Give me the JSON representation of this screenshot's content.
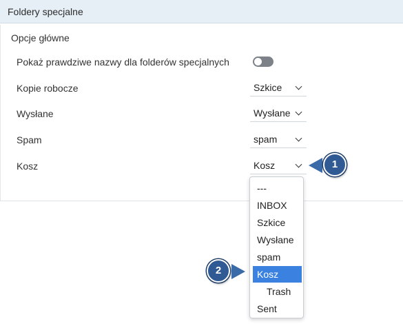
{
  "header": {
    "title": "Foldery specjalne"
  },
  "section": {
    "legend": "Opcje główne"
  },
  "rows": [
    {
      "label": "Pokaż prawdziwe nazwy dla folderów specjalnych",
      "type": "toggle",
      "enabled": false
    },
    {
      "label": "Kopie robocze",
      "type": "select",
      "value": "Szkice"
    },
    {
      "label": "Wysłane",
      "type": "select",
      "value": "Wysłane"
    },
    {
      "label": "Spam",
      "type": "select",
      "value": "spam"
    },
    {
      "label": "Kosz",
      "type": "select",
      "value": "Kosz"
    }
  ],
  "dropdown": {
    "options": [
      {
        "label": "---",
        "selected": false,
        "child": false
      },
      {
        "label": "INBOX",
        "selected": false,
        "child": false
      },
      {
        "label": "Szkice",
        "selected": false,
        "child": false
      },
      {
        "label": "Wysłane",
        "selected": false,
        "child": false
      },
      {
        "label": "spam",
        "selected": false,
        "child": false
      },
      {
        "label": "Kosz",
        "selected": true,
        "child": false
      },
      {
        "label": "Trash",
        "selected": false,
        "child": true
      },
      {
        "label": "Sent",
        "selected": false,
        "child": false
      }
    ]
  },
  "callouts": [
    {
      "number": "1"
    },
    {
      "number": "2"
    }
  ],
  "colors": {
    "header_bg": "#e6eef6",
    "selected_option": "#3b82e0",
    "callout": "#2f5a93"
  },
  "icons": {
    "select_chevron": "chevron-down-icon"
  }
}
